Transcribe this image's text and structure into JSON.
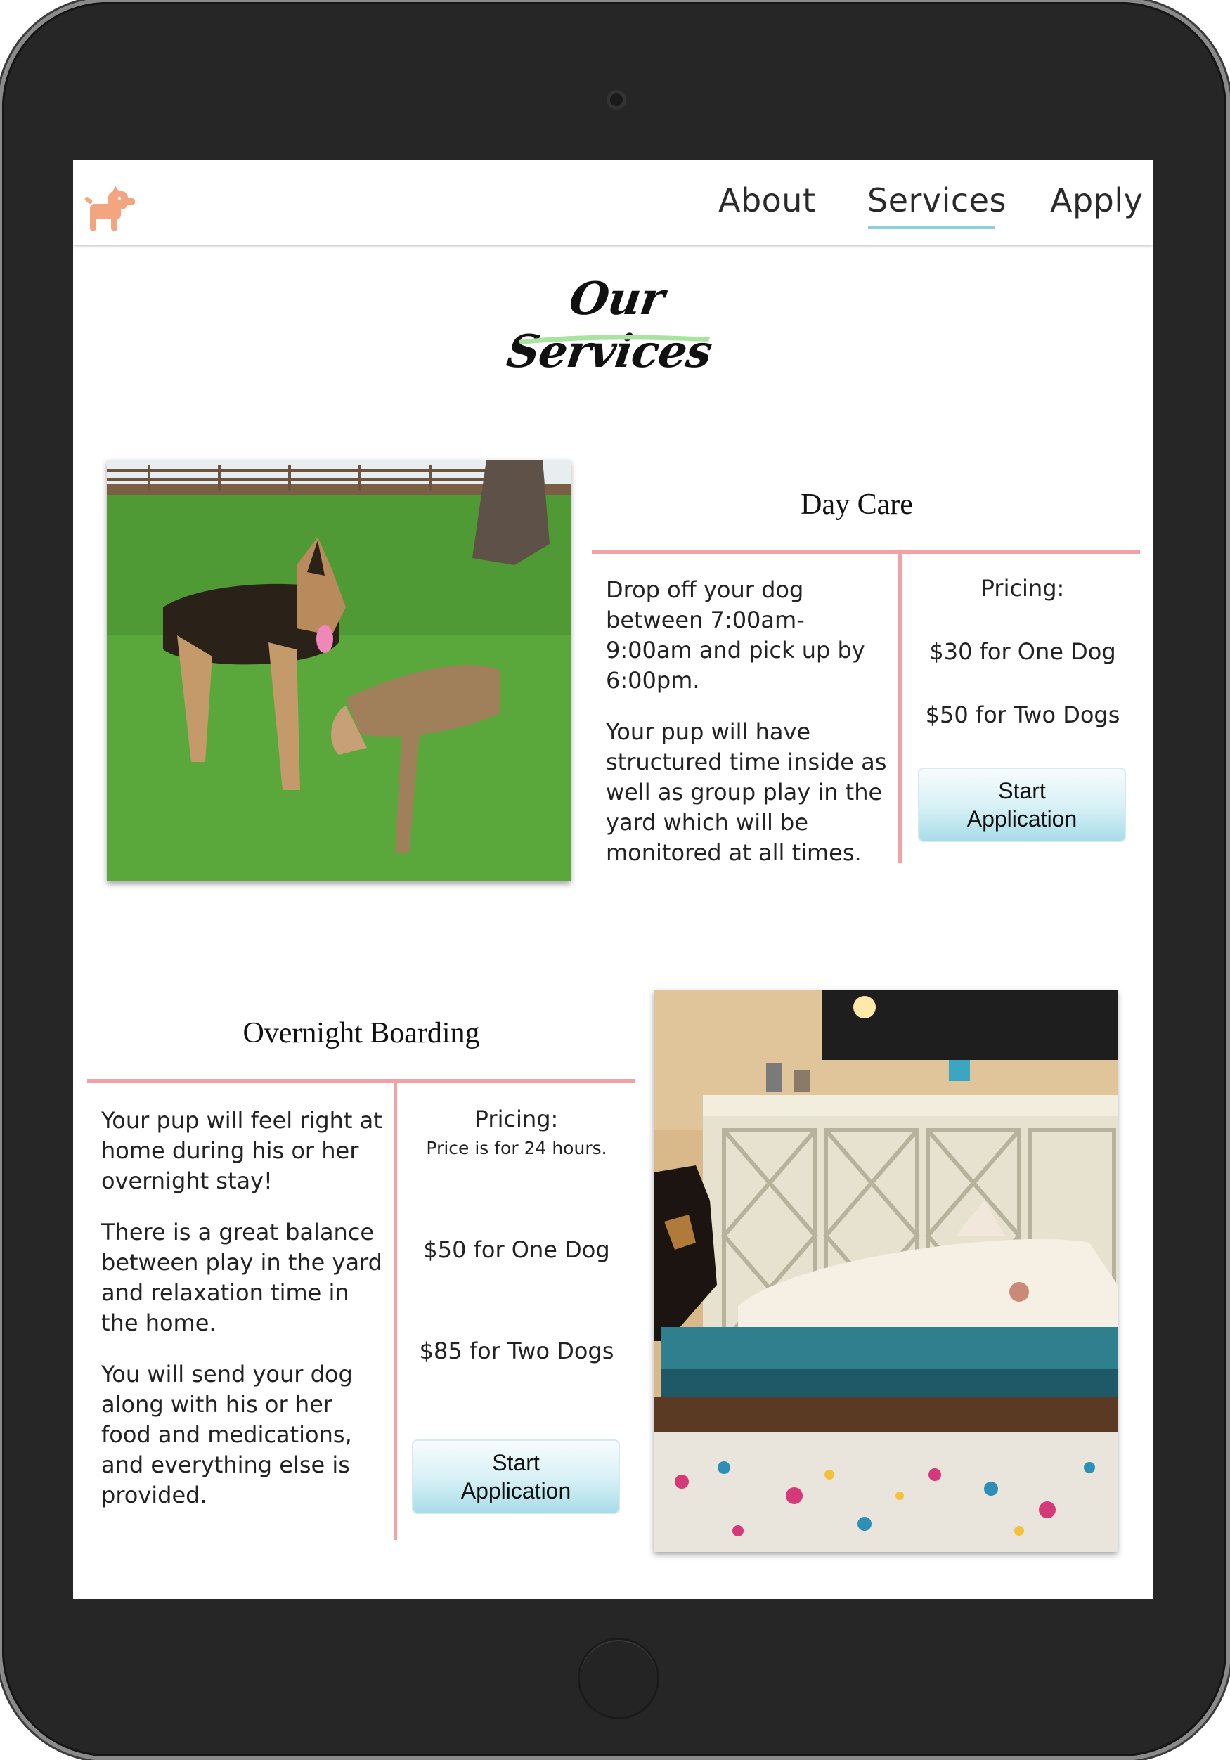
{
  "nav": {
    "about": "About",
    "services": "Services",
    "apply": "Apply"
  },
  "page": {
    "title": "Our Services"
  },
  "day_care": {
    "title": "Day Care",
    "description": [
      "Drop off your dog between 7:00am-9:00am and pick up by 6:00pm.",
      "Your pup will have structured time inside as well as group play in the yard which will be monitored at all times."
    ],
    "pricing_label": "Pricing:",
    "price_one": "$30 for One Dog",
    "price_two": "$50 for Two Dogs",
    "button": "Start Application"
  },
  "overnight": {
    "title": "Overnight Boarding",
    "description": [
      "Your pup will feel right at home during his or her overnight stay!",
      "There is a great balance between play in the yard and relaxation time in the home.",
      "You will send your dog along with his or her food and medications, and everything else is provided."
    ],
    "pricing_label": "Pricing:",
    "pricing_note": "Price is for 24 hours.",
    "price_one": "$50 for One Dog",
    "price_two": "$85 for Two Dogs",
    "button": "Start Application"
  },
  "colors": {
    "accent_pink": "#f4a1a5",
    "nav_underline": "#89d1dc",
    "logo": "#f3a57f",
    "brush": "#a8e4a0"
  },
  "icons": {
    "logo": "dog-icon"
  }
}
